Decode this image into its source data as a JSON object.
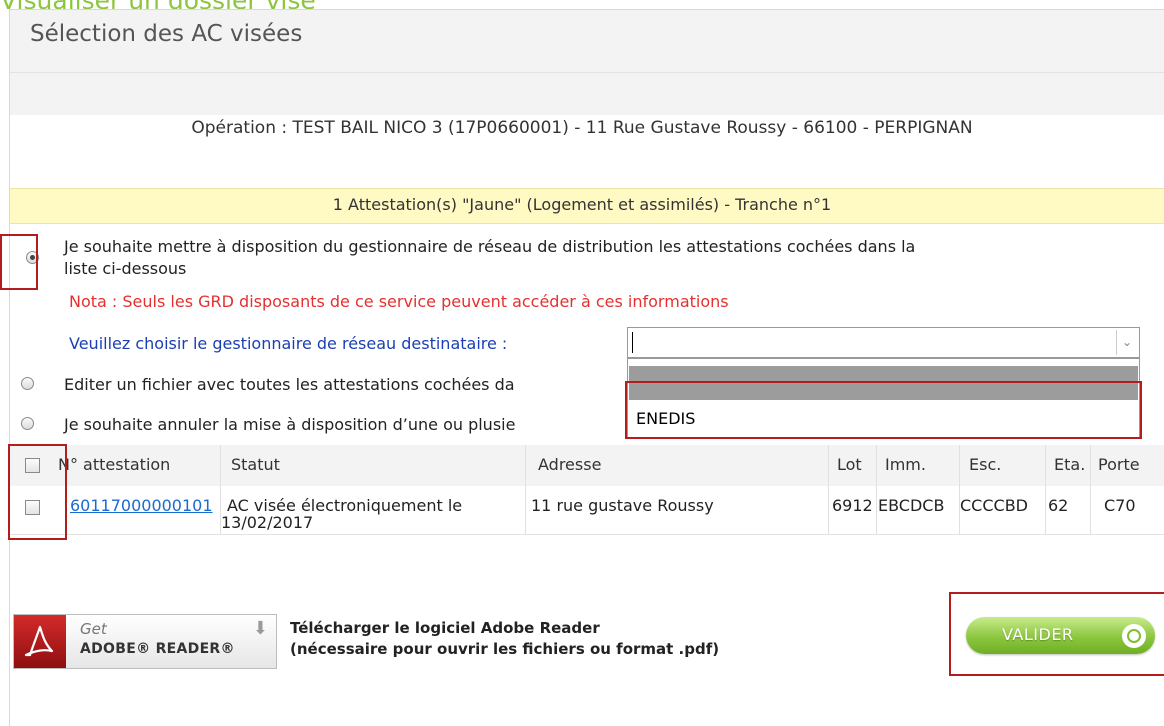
{
  "page": {
    "title": "Visualiser un dossier visé"
  },
  "section": {
    "header": "Sélection des AC visées",
    "operation": "Opération : TEST BAIL NICO 3 (17P0660001) - 11 Rue Gustave Roussy - 66100 - PERPIGNAN",
    "attestation_summary": "1 Attestation(s) \"Jaune\" (Logement et assimilés) - Tranche n°1"
  },
  "options": {
    "option1_line1": "Je souhaite mettre à disposition du gestionnaire de réseau de distribution les attestations cochées dans la",
    "option1_line2": "liste ci-dessous",
    "nota": "Nota : Seuls les GRD disposants de ce service peuvent accéder à ces informations",
    "select_label": "Veuillez choisir le gestionnaire de réseau destinataire :",
    "select_value": "",
    "select_options": [
      "",
      "ENEDIS"
    ],
    "option2": "Editer un fichier avec toutes les attestations cochées da",
    "option3": "Je souhaite annuler la mise à disposition d’une ou plusie"
  },
  "table": {
    "columns": [
      "N° attestation",
      "Statut",
      "Adresse",
      "Lot",
      "Imm.",
      "Esc.",
      "Eta.",
      "Porte"
    ],
    "rows": [
      {
        "numero": "60117000000101",
        "statut_line1": "AC visée électroniquement le",
        "statut_line2": "13/02/2017",
        "adresse": "11 rue gustave Roussy",
        "lot": "6912",
        "imm": "EBCDCB",
        "esc": "CCCCBD",
        "eta": "62",
        "porte": "C70"
      }
    ]
  },
  "footer": {
    "adobe_get": "Get",
    "adobe_reader": "ADOBE® READER®",
    "download_line1": "Télécharger le logiciel Adobe Reader",
    "download_line2": "(nécessaire pour ouvrir les fichiers ou format .pdf)",
    "valider_label": "VALIDER"
  },
  "colors": {
    "title_green": "#8cc63f",
    "highlight_yellow": "#fff9c4",
    "nota_red": "#e53030",
    "label_blue": "#1a3fb5",
    "annotation_red": "#b21d1d"
  }
}
